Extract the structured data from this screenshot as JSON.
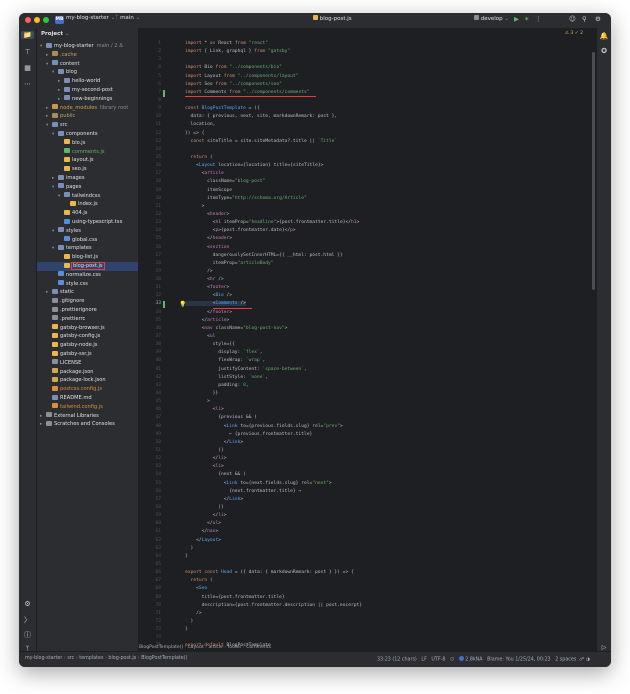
{
  "titlebar": {
    "project_badge": "MB",
    "project_name": "my-blog-starter",
    "branch": "main",
    "file_tab": "blog-post.js",
    "run_config": "develop",
    "colors": {
      "badge": "#4a6cc7",
      "close": "#ff5f57",
      "min": "#febc2e",
      "max": "#28c840"
    }
  },
  "project_panel": {
    "title": "Project",
    "items": [
      {
        "label": "my-blog-starter",
        "extra": "main / 2 Δ",
        "depth": 0,
        "kind": "folder",
        "open": true
      },
      {
        "label": ".cache",
        "depth": 1,
        "kind": "folder-muted",
        "open": false
      },
      {
        "label": "content",
        "depth": 1,
        "kind": "folder",
        "open": true
      },
      {
        "label": "blog",
        "depth": 2,
        "kind": "folder",
        "open": true
      },
      {
        "label": "hello-world",
        "depth": 3,
        "kind": "folder",
        "open": false
      },
      {
        "label": "my-second-post",
        "depth": 3,
        "kind": "folder",
        "open": false
      },
      {
        "label": "new-beginnings",
        "depth": 3,
        "kind": "folder",
        "open": false
      },
      {
        "label": "node_modules",
        "extra": "library root",
        "depth": 1,
        "kind": "folder-lib",
        "open": false
      },
      {
        "label": "public",
        "depth": 1,
        "kind": "folder-muted",
        "open": false
      },
      {
        "label": "src",
        "depth": 1,
        "kind": "folder",
        "open": true
      },
      {
        "label": "components",
        "depth": 2,
        "kind": "folder",
        "open": true
      },
      {
        "label": "bio.js",
        "depth": 3,
        "kind": "js"
      },
      {
        "label": "comments.js",
        "depth": 3,
        "kind": "js-green"
      },
      {
        "label": "layout.js",
        "depth": 3,
        "kind": "js"
      },
      {
        "label": "seo.js",
        "depth": 3,
        "kind": "js"
      },
      {
        "label": "images",
        "depth": 2,
        "kind": "folder",
        "open": false
      },
      {
        "label": "pages",
        "depth": 2,
        "kind": "folder",
        "open": true
      },
      {
        "label": "tailwindcss",
        "depth": 3,
        "kind": "folder",
        "open": true
      },
      {
        "label": "index.js",
        "depth": 4,
        "kind": "js"
      },
      {
        "label": "404.js",
        "depth": 3,
        "kind": "js"
      },
      {
        "label": "using-typescript.tsx",
        "depth": 3,
        "kind": "ts"
      },
      {
        "label": "styles",
        "depth": 2,
        "kind": "folder",
        "open": true
      },
      {
        "label": "global.css",
        "depth": 3,
        "kind": "css"
      },
      {
        "label": "templates",
        "depth": 2,
        "kind": "folder",
        "open": true
      },
      {
        "label": "blog-list.js",
        "depth": 3,
        "kind": "js"
      },
      {
        "label": "blog-post.js",
        "depth": 3,
        "kind": "js",
        "selected": true
      },
      {
        "label": "normalize.css",
        "depth": 2,
        "kind": "css"
      },
      {
        "label": "style.css",
        "depth": 2,
        "kind": "css"
      },
      {
        "label": "static",
        "depth": 1,
        "kind": "folder",
        "open": false
      },
      {
        "label": ".gitignore",
        "depth": 1,
        "kind": "txt"
      },
      {
        "label": ".prettierignore",
        "depth": 1,
        "kind": "txt"
      },
      {
        "label": ".prettierrc",
        "depth": 1,
        "kind": "txt"
      },
      {
        "label": "gatsby-browser.js",
        "depth": 1,
        "kind": "js"
      },
      {
        "label": "gatsby-config.js",
        "depth": 1,
        "kind": "js"
      },
      {
        "label": "gatsby-node.js",
        "depth": 1,
        "kind": "js"
      },
      {
        "label": "gatsby-ssr.js",
        "depth": 1,
        "kind": "js"
      },
      {
        "label": "LICENSE",
        "depth": 1,
        "kind": "txt"
      },
      {
        "label": "package.json",
        "depth": 1,
        "kind": "json"
      },
      {
        "label": "package-lock.json",
        "depth": 1,
        "kind": "json"
      },
      {
        "label": "postcss.config.js",
        "depth": 1,
        "kind": "js-orange"
      },
      {
        "label": "README.md",
        "depth": 1,
        "kind": "md"
      },
      {
        "label": "tailwind.config.js",
        "depth": 1,
        "kind": "js-orange"
      },
      {
        "label": "External Libraries",
        "depth": 0,
        "kind": "lib",
        "open": false
      },
      {
        "label": "Scratches and Consoles",
        "depth": 0,
        "kind": "scratch",
        "open": false
      }
    ]
  },
  "editor": {
    "inspections": "⚠ 3  ✓ 2",
    "lines": [
      [
        [
          "k",
          "import"
        ],
        [
          "p",
          " * "
        ],
        [
          "k",
          "as"
        ],
        [
          "p",
          " React "
        ],
        [
          "k",
          "from"
        ],
        [
          "s",
          " \"react\""
        ]
      ],
      [
        [
          "k",
          "import"
        ],
        [
          "p",
          " { Link, graphql } "
        ],
        [
          "k",
          "from"
        ],
        [
          "s",
          " \"gatsby\""
        ]
      ],
      [],
      [
        [
          "k",
          "import"
        ],
        [
          "p",
          " Bio "
        ],
        [
          "k",
          "from"
        ],
        [
          "s",
          " \"../components/bio\""
        ]
      ],
      [
        [
          "k",
          "import"
        ],
        [
          "p",
          " Layout "
        ],
        [
          "k",
          "from"
        ],
        [
          "s",
          " \"../components/layout\""
        ]
      ],
      [
        [
          "k",
          "import"
        ],
        [
          "p",
          " Seo "
        ],
        [
          "k",
          "from"
        ],
        [
          "s",
          " \"../components/seo\""
        ]
      ],
      [
        [
          "k",
          "import"
        ],
        [
          "p",
          " Comments "
        ],
        [
          "k",
          "from"
        ],
        [
          "s",
          " \"../components/comments\""
        ]
      ],
      [],
      [
        [
          "k",
          "const"
        ],
        [
          "t",
          " BlogPostTemplate"
        ],
        [
          "p",
          " = ({"
        ]
      ],
      [
        [
          "p",
          "  data: { previous, next, site, markdownRemark: post },"
        ]
      ],
      [
        [
          "p",
          "  location,"
        ]
      ],
      [
        [
          "p",
          "}) => {"
        ]
      ],
      [
        [
          "p",
          "  "
        ],
        [
          "k",
          "const"
        ],
        [
          "p",
          " siteTitle = site.siteMetadata?.title || "
        ],
        [
          "s",
          "`Title`"
        ]
      ],
      [],
      [
        [
          "p",
          "  "
        ],
        [
          "k",
          "return"
        ],
        [
          "p",
          " ("
        ]
      ],
      [
        [
          "p",
          "    <"
        ],
        [
          "t",
          "Layout"
        ],
        [
          "a",
          " location"
        ],
        [
          "p",
          "={location}"
        ],
        [
          "a",
          " title"
        ],
        [
          "p",
          "={siteTitle}>"
        ]
      ],
      [
        [
          "p",
          "      <"
        ],
        [
          "c",
          "article"
        ]
      ],
      [
        [
          "a",
          "        className"
        ],
        [
          "p",
          "="
        ],
        [
          "s",
          "\"blog-post\""
        ]
      ],
      [
        [
          "a",
          "        itemScope"
        ]
      ],
      [
        [
          "a",
          "        itemType"
        ],
        [
          "p",
          "="
        ],
        [
          "s",
          "\"http://schema.org/Article\""
        ]
      ],
      [
        [
          "p",
          "      >"
        ]
      ],
      [
        [
          "p",
          "        <"
        ],
        [
          "c",
          "header"
        ],
        [
          "p",
          ">"
        ]
      ],
      [
        [
          "p",
          "          <"
        ],
        [
          "c",
          "h1"
        ],
        [
          "a",
          " itemProp"
        ],
        [
          "p",
          "="
        ],
        [
          "s",
          "\"headline\""
        ],
        [
          "p",
          ">{post.frontmatter.title}</"
        ],
        [
          "c",
          "h1"
        ],
        [
          "p",
          ">"
        ]
      ],
      [
        [
          "p",
          "          <"
        ],
        [
          "c",
          "p"
        ],
        [
          "p",
          ">{post.frontmatter.date}</"
        ],
        [
          "c",
          "p"
        ],
        [
          "p",
          ">"
        ]
      ],
      [
        [
          "p",
          "        </"
        ],
        [
          "c",
          "header"
        ],
        [
          "p",
          ">"
        ]
      ],
      [
        [
          "p",
          "        <"
        ],
        [
          "c",
          "section"
        ]
      ],
      [
        [
          "a",
          "          dangerouslySetInnerHTML"
        ],
        [
          "p",
          "={{ __html: post.html }}"
        ]
      ],
      [
        [
          "a",
          "          itemProp"
        ],
        [
          "p",
          "="
        ],
        [
          "s",
          "\"articleBody\""
        ]
      ],
      [
        [
          "p",
          "        />"
        ]
      ],
      [
        [
          "p",
          "        <"
        ],
        [
          "c",
          "hr"
        ],
        [
          "p",
          " />"
        ]
      ],
      [
        [
          "p",
          "        <"
        ],
        [
          "c",
          "footer"
        ],
        [
          "p",
          ">"
        ]
      ],
      [
        [
          "p",
          "          <"
        ],
        [
          "t",
          "Bio"
        ],
        [
          "p",
          " />"
        ]
      ],
      [
        [
          "p",
          "          <"
        ],
        [
          "t",
          "Comments"
        ],
        [
          "p",
          " />"
        ]
      ],
      [
        [
          "p",
          "        </"
        ],
        [
          "c",
          "footer"
        ],
        [
          "p",
          ">"
        ]
      ],
      [
        [
          "p",
          "      </"
        ],
        [
          "c",
          "article"
        ],
        [
          "p",
          ">"
        ]
      ],
      [
        [
          "p",
          "      <"
        ],
        [
          "c",
          "nav"
        ],
        [
          "a",
          " className"
        ],
        [
          "p",
          "="
        ],
        [
          "s",
          "\"blog-post-nav\""
        ],
        [
          "p",
          ">"
        ]
      ],
      [
        [
          "p",
          "        <"
        ],
        [
          "c",
          "ul"
        ]
      ],
      [
        [
          "a",
          "          style"
        ],
        [
          "p",
          "={{"
        ]
      ],
      [
        [
          "p",
          "            display: "
        ],
        [
          "s",
          "`flex`"
        ],
        [
          "p",
          ","
        ]
      ],
      [
        [
          "p",
          "            flexWrap: "
        ],
        [
          "s",
          "`wrap`"
        ],
        [
          "p",
          ","
        ]
      ],
      [
        [
          "p",
          "            justifyContent: "
        ],
        [
          "s",
          "`space-between`"
        ],
        [
          "p",
          ","
        ]
      ],
      [
        [
          "p",
          "            listStyle: "
        ],
        [
          "s",
          "`none`"
        ],
        [
          "p",
          ","
        ]
      ],
      [
        [
          "p",
          "            padding: "
        ],
        [
          "n",
          "0"
        ],
        [
          "p",
          ","
        ]
      ],
      [
        [
          "p",
          "          }}"
        ]
      ],
      [
        [
          "p",
          "        >"
        ]
      ],
      [
        [
          "p",
          "          <"
        ],
        [
          "c",
          "li"
        ],
        [
          "p",
          ">"
        ]
      ],
      [
        [
          "p",
          "            {previous && ("
        ]
      ],
      [
        [
          "p",
          "              <"
        ],
        [
          "t",
          "Link"
        ],
        [
          "a",
          " to"
        ],
        [
          "p",
          "={previous.fields.slug}"
        ],
        [
          "a",
          " rel"
        ],
        [
          "p",
          "="
        ],
        [
          "s",
          "\"prev\""
        ],
        [
          "p",
          ">"
        ]
      ],
      [
        [
          "p",
          "                ← {previous.frontmatter.title}"
        ]
      ],
      [
        [
          "p",
          "              </"
        ],
        [
          "t",
          "Link"
        ],
        [
          "p",
          ">"
        ]
      ],
      [
        [
          "p",
          "            )}"
        ]
      ],
      [
        [
          "p",
          "          </"
        ],
        [
          "c",
          "li"
        ],
        [
          "p",
          ">"
        ]
      ],
      [
        [
          "p",
          "          <"
        ],
        [
          "c",
          "li"
        ],
        [
          "p",
          ">"
        ]
      ],
      [
        [
          "p",
          "            {next && ("
        ]
      ],
      [
        [
          "p",
          "              <"
        ],
        [
          "t",
          "Link"
        ],
        [
          "a",
          " to"
        ],
        [
          "p",
          "={next.fields.slug}"
        ],
        [
          "a",
          " rel"
        ],
        [
          "p",
          "="
        ],
        [
          "s",
          "\"next\""
        ],
        [
          "p",
          ">"
        ]
      ],
      [
        [
          "p",
          "                {next.frontmatter.title} →"
        ]
      ],
      [
        [
          "p",
          "              </"
        ],
        [
          "t",
          "Link"
        ],
        [
          "p",
          ">"
        ]
      ],
      [
        [
          "p",
          "            )}"
        ]
      ],
      [
        [
          "p",
          "          </"
        ],
        [
          "c",
          "li"
        ],
        [
          "p",
          ">"
        ]
      ],
      [
        [
          "p",
          "        </"
        ],
        [
          "c",
          "ul"
        ],
        [
          "p",
          ">"
        ]
      ],
      [
        [
          "p",
          "      </"
        ],
        [
          "c",
          "nav"
        ],
        [
          "p",
          ">"
        ]
      ],
      [
        [
          "p",
          "    </"
        ],
        [
          "t",
          "Layout"
        ],
        [
          "p",
          ">"
        ]
      ],
      [
        [
          "p",
          "  )"
        ]
      ],
      [
        [
          "p",
          "}"
        ]
      ],
      [],
      [
        [
          "k",
          "export const"
        ],
        [
          "t",
          " Head"
        ],
        [
          "p",
          " = ({ data: { markdownRemark: post } }) => {"
        ]
      ],
      [
        [
          "p",
          "  "
        ],
        [
          "k",
          "return"
        ],
        [
          "p",
          " ("
        ]
      ],
      [
        [
          "p",
          "    <"
        ],
        [
          "t",
          "Seo"
        ]
      ],
      [
        [
          "a",
          "      title"
        ],
        [
          "p",
          "={post.frontmatter.title}"
        ]
      ],
      [
        [
          "a",
          "      description"
        ],
        [
          "p",
          "={post.frontmatter.description || post.excerpt}"
        ]
      ],
      [
        [
          "p",
          "    />"
        ]
      ],
      [
        [
          "p",
          "  )"
        ]
      ],
      [
        [
          "p",
          "}"
        ]
      ],
      [],
      [
        [
          "k",
          "export default"
        ],
        [
          "p",
          " BlogPostTemplate"
        ]
      ]
    ],
    "breadcrumb": [
      "BlogPostTemplate()",
      "Layout",
      "article",
      "footer",
      "Comments"
    ]
  },
  "statusbar": {
    "path": [
      "my-blog-starter",
      "src",
      "templates",
      "blog-post.js",
      "BlogPostTemplate()"
    ],
    "position": "33:23 (12 chars)",
    "line_sep": "LF",
    "encoding": "UTF-8",
    "memory": "2.8kNA",
    "blame": "Blame: You 1/25/24, 00:23",
    "indent": "2 spaces"
  }
}
